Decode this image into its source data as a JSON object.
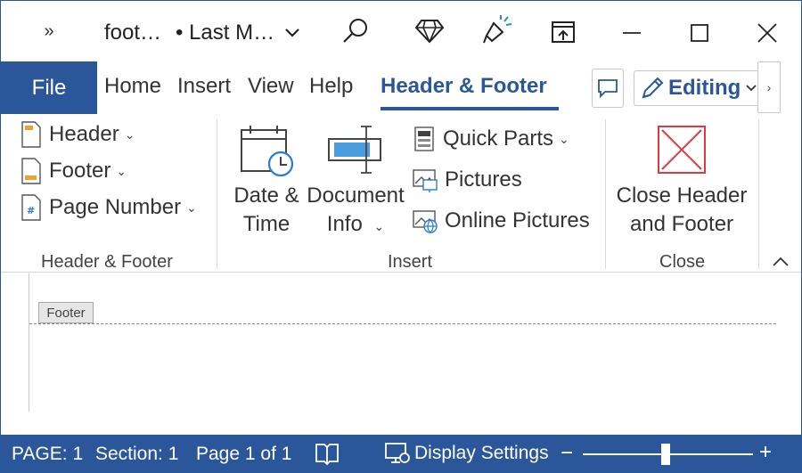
{
  "titlebar": {
    "overflow_icon": "»",
    "doc_name": "foot…",
    "save_status": "• Last M…",
    "icons": [
      "search-icon",
      "diamond-icon",
      "lightbulb-icon",
      "ribbon-display-icon"
    ],
    "window_buttons": [
      "minimize",
      "maximize",
      "close"
    ]
  },
  "tabs": {
    "file": "File",
    "items": [
      "Home",
      "Insert",
      "View",
      "Help",
      "Header & Footer"
    ],
    "active": "Header & Footer",
    "editing_label": "Editing",
    "more_icon": "›"
  },
  "ribbon": {
    "groups": {
      "header_footer": {
        "label": "Header & Footer",
        "items": [
          "Header",
          "Footer",
          "Page Number"
        ]
      },
      "insert": {
        "label": "Insert",
        "date_time": [
          "Date &",
          "Time"
        ],
        "document_info": [
          "Document",
          "Info"
        ],
        "items": [
          "Quick Parts",
          "Pictures",
          "Online Pictures"
        ]
      },
      "close": {
        "label": "Close",
        "close_button": [
          "Close Header",
          "and Footer"
        ]
      }
    },
    "colors": {
      "accent": "#2b579a",
      "close_red": "#e0393e"
    }
  },
  "document": {
    "footer_tag": "Footer"
  },
  "statusbar": {
    "page": "PAGE: 1",
    "section": "Section: 1",
    "page_of": "Page 1 of 1",
    "display_settings": "Display Settings",
    "zoom_minus": "−",
    "zoom_plus": "+"
  }
}
